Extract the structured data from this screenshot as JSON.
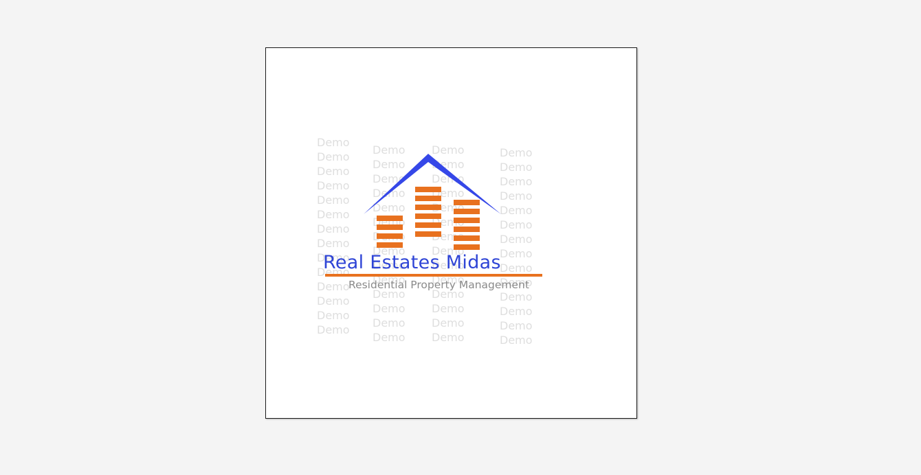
{
  "logo": {
    "brand_name": "Real Estates Midas",
    "tagline": "Residential Property Management",
    "watermark_text": "Demo"
  },
  "colors": {
    "page_background": "#f4f4f4",
    "canvas_background": "#ffffff",
    "canvas_border": "#1a1a1a",
    "roof_blue": "#3547e8",
    "building_orange": "#e8711f",
    "brand_text_blue": "#2f45d6",
    "tagline_gray": "#8a8a8a",
    "watermark_gray": "#dedede"
  },
  "icons": [
    "house-roof-icon",
    "building-icon"
  ]
}
